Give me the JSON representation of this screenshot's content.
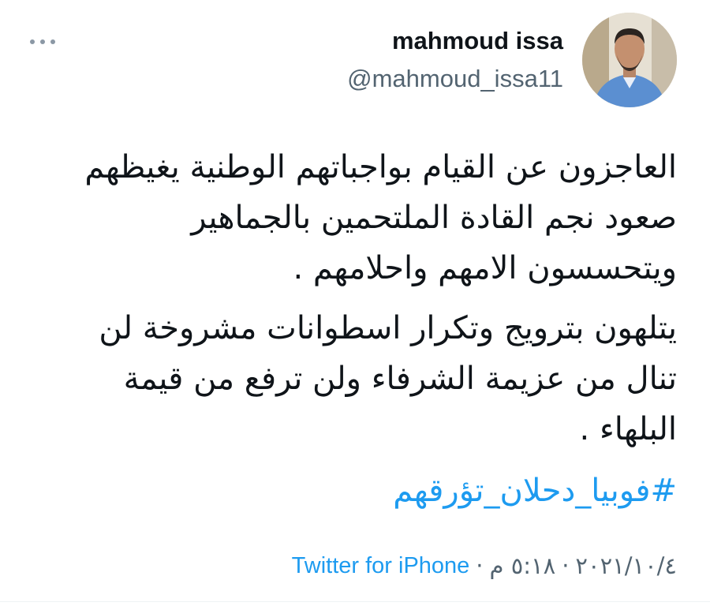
{
  "author": {
    "name": "mahmoud issa",
    "handle": "@mahmoud_issa11"
  },
  "tweet": {
    "paragraphs": [
      "العاجزون عن القيام بواجباتهم الوطنية يغيظهم صعود نجم القادة الملتحمين بالجماهير ويتحسسون الامهم واحلامهم .",
      "يتلهون بترويج وتكرار اسطوانات مشروخة لن تنال من عزيمة الشرفاء ولن ترفع من قيمة البلهاء ."
    ],
    "hashtag": "#فوبيا_دحلان_تؤرقهم",
    "date": "٢٠٢١/١٠/٤",
    "time": "٥:١٨ م",
    "separator": "·",
    "source": "Twitter for iPhone"
  },
  "colors": {
    "link": "#1d9bf0",
    "secondary_text": "#536471",
    "primary_text": "#0f1419"
  },
  "icons": {
    "more": "more-dots-icon"
  }
}
